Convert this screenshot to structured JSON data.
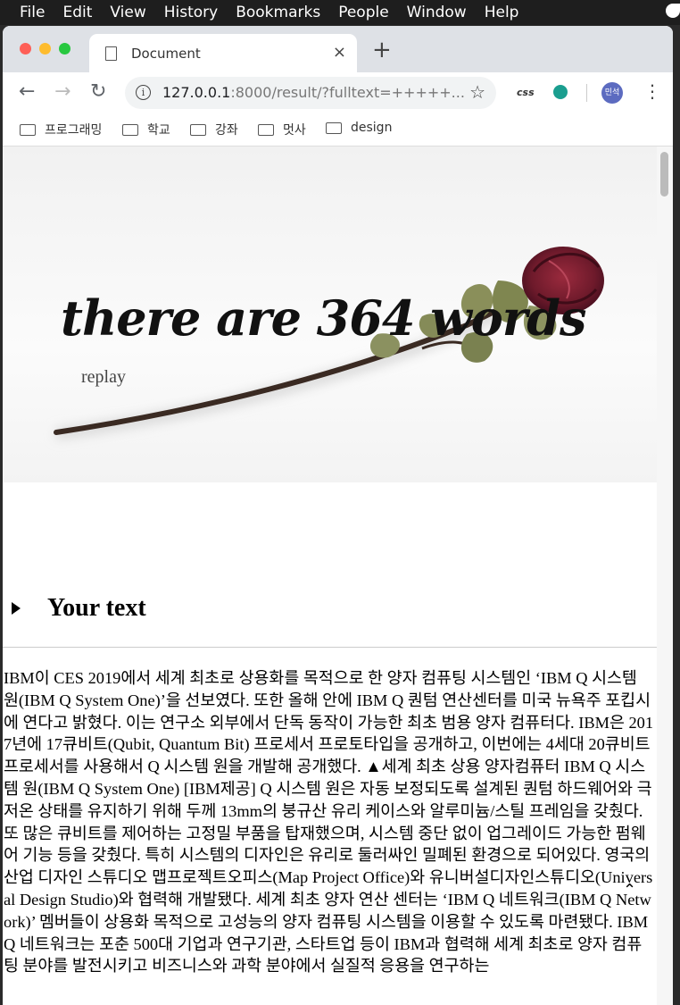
{
  "menubar": {
    "items": [
      "File",
      "Edit",
      "View",
      "History",
      "Bookmarks",
      "People",
      "Window",
      "Help"
    ]
  },
  "tab": {
    "title": "Document",
    "close": "×",
    "new": "+"
  },
  "toolbar": {
    "url_host": "127.0.0.1",
    "url_rest": ":8000/result/?fulltext=+++++...",
    "ext_css": "css",
    "avatar": "민석"
  },
  "bookmarks": [
    "프로그래밍",
    "학교",
    "강좌",
    "멋사",
    "design"
  ],
  "hero": {
    "headline": "there are 364 words",
    "replay": "replay"
  },
  "section": {
    "summary": "Your text"
  },
  "body_text": "IBM이 CES 2019에서 세계 최초로 상용화를 목적으로 한 양자 컴퓨팅 시스템인 ‘IBM Q 시스템 원(IBM Q System One)’을 선보였다. 또한 올해 안에 IBM Q 퀀텀 연산센터를 미국 뉴욕주 포킵시에 연다고 밝혔다. 이는 연구소 외부에서 단독 동작이 가능한 최초 범용 양자 컴퓨터다. IBM은 2017년에 17큐비트(Qubit, Quantum Bit) 프로세서 프로토타입을 공개하고, 이번에는 4세대 20큐비트 프로세서를 사용해서 Q 시스템 원을 개발해 공개했다. ▲세계 최초 상용 양자컴퓨터 IBM Q 시스템 원(IBM Q System One) [IBM제공] Q 시스템 원은 자동 보정되도록 설계된 퀀텀 하드웨어와 극저온 상태를 유지하기 위해 두께 13mm의 붕규산 유리 케이스와 알루미늄/스틸 프레임을 갖췄다. 또 많은 큐비트를 제어하는 고정밀 부품을 탑재했으며, 시스템 중단 없이 업그레이드 가능한 펌웨어 기능 등을 갖췄다. 특히 시스템의 디자인은 유리로 둘러싸인 밀폐된 환경으로 되어있다. 영국의 산업 디자인 스튜디오 맵프로젝트오피스(Map Project Office)와 유니버설디자인스튜디오(Universal Design Studio)와 협력해 개발됐다. 세계 최초 양자 연산 센터는 ‘IBM Q 네트워크(IBM Q Network)’ 멤버들이 상용화 목적으로 고성능의 양자 컴퓨팅 시스템을 이용할 수 있도록 마련됐다. IBM Q 네트워크는 포춘 500대 기업과 연구기관, 스타트업 등이 IBM과 협력해 세계 최초로 양자 컴퓨팅 분야를 발전시키고 비즈니스와 과학 분야에서 실질적 응용을 연구하는",
  "scroll_top": "⌃",
  "colors": {
    "accent": "#5c6bc0",
    "palette": "#1a9e8f"
  }
}
